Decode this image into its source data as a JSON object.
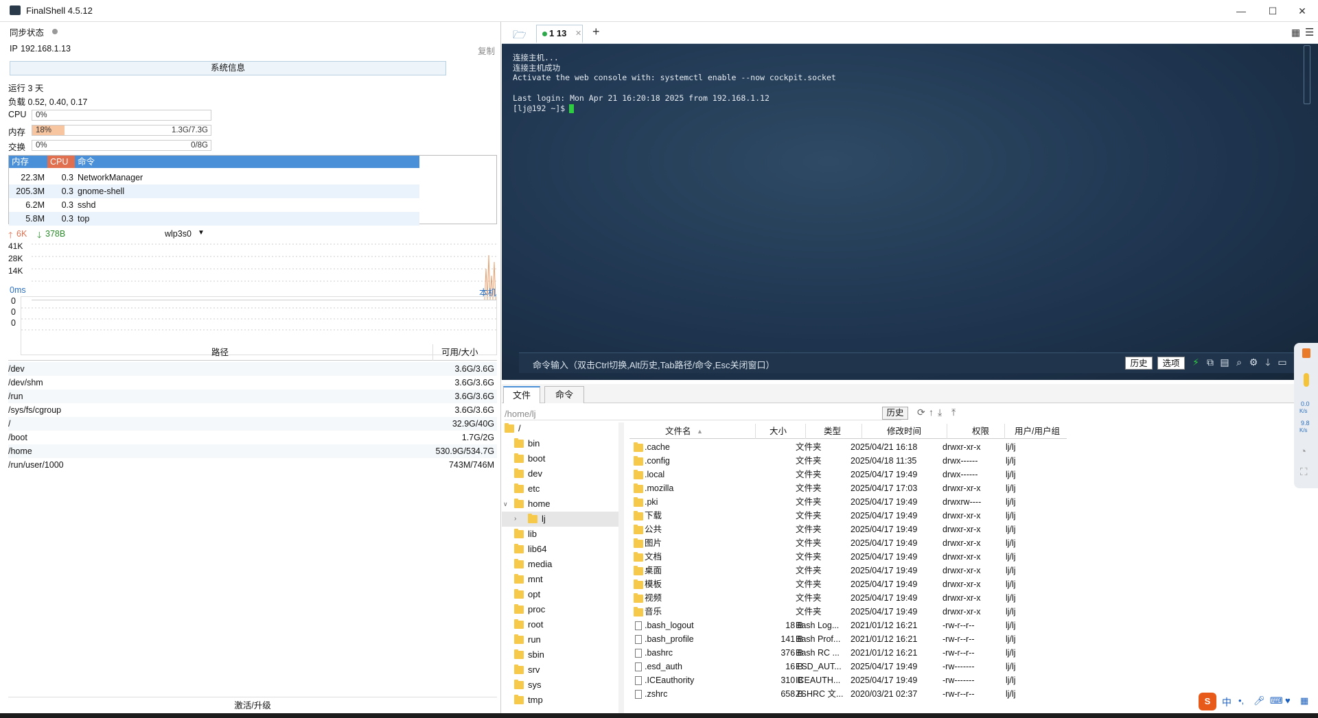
{
  "app": {
    "title": "FinalShell 4.5.12"
  },
  "window": {
    "minimize": "—",
    "maximize": "☐",
    "close": "✕"
  },
  "left": {
    "sync_label": "同步状态",
    "ip_label": "IP",
    "ip_value": "192.168.1.13",
    "copy_label": "复制",
    "sysinfo_button": "系统信息",
    "uptime": "运行 3 天",
    "load": "负载 0.52, 0.40, 0.17",
    "cpu_label": "CPU",
    "cpu_text": "0%",
    "cpu_percent": 0,
    "mem_label": "内存",
    "mem_text": "18%",
    "mem_size": "1.3G/7.3G",
    "mem_percent": 18,
    "swap_label": "交换",
    "swap_text": "0%",
    "swap_size": "0/8G",
    "swap_percent": 0,
    "proc_headers": [
      "内存",
      "CPU",
      "命令"
    ],
    "processes": [
      {
        "mem": "22.3M",
        "cpu": "0.3",
        "cmd": "NetworkManager"
      },
      {
        "mem": "205.3M",
        "cpu": "0.3",
        "cmd": "gnome-shell"
      },
      {
        "mem": "6.2M",
        "cpu": "0.3",
        "cmd": "sshd"
      },
      {
        "mem": "5.8M",
        "cpu": "0.3",
        "cmd": "top"
      }
    ],
    "net_up": "6K",
    "net_down": "378B",
    "net_iface": "wlp3s0",
    "net_ticks": [
      "41K",
      "28K",
      "14K"
    ],
    "ping_label": "0ms",
    "ping_target": "本机",
    "ping_ticks": [
      "0",
      "0",
      "0"
    ],
    "disk_headers": [
      "路径",
      "可用/大小"
    ],
    "disks": [
      {
        "path": "/dev",
        "size": "3.6G/3.6G"
      },
      {
        "path": "/dev/shm",
        "size": "3.6G/3.6G"
      },
      {
        "path": "/run",
        "size": "3.6G/3.6G"
      },
      {
        "path": "/sys/fs/cgroup",
        "size": "3.6G/3.6G"
      },
      {
        "path": "/",
        "size": "32.9G/40G"
      },
      {
        "path": "/boot",
        "size": "1.7G/2G"
      },
      {
        "path": "/home",
        "size": "530.9G/534.7G"
      },
      {
        "path": "/run/user/1000",
        "size": "743M/746M"
      }
    ],
    "activate": "激活/升级"
  },
  "tabs": {
    "session": "1 13",
    "add": "+"
  },
  "terminal": {
    "lines": [
      "连接主机...",
      "连接主机成功",
      "Activate the web console with: systemctl enable --now cockpit.socket",
      "",
      "Last login: Mon Apr 21 16:20:18 2025 from 192.168.1.12",
      "[lj@192 ~]$ "
    ],
    "cmd_hint": "命令输入（双击Ctrl切换,Alt历史,Tab路径/命令,Esc关闭窗口）",
    "history_btn": "历史",
    "options_btn": "选项"
  },
  "files": {
    "tab_files": "文件",
    "tab_cmds": "命令",
    "path": "/home/lj",
    "history_btn": "历史",
    "tree": [
      {
        "name": "/",
        "level": 0
      },
      {
        "name": "bin",
        "level": 1
      },
      {
        "name": "boot",
        "level": 1
      },
      {
        "name": "dev",
        "level": 1
      },
      {
        "name": "etc",
        "level": 1
      },
      {
        "name": "home",
        "level": 1
      },
      {
        "name": "lj",
        "level": 2
      },
      {
        "name": "lib",
        "level": 1
      },
      {
        "name": "lib64",
        "level": 1
      },
      {
        "name": "media",
        "level": 1
      },
      {
        "name": "mnt",
        "level": 1
      },
      {
        "name": "opt",
        "level": 1
      },
      {
        "name": "proc",
        "level": 1
      },
      {
        "name": "root",
        "level": 1
      },
      {
        "name": "run",
        "level": 1
      },
      {
        "name": "sbin",
        "level": 1
      },
      {
        "name": "srv",
        "level": 1
      },
      {
        "name": "sys",
        "level": 1
      },
      {
        "name": "tmp",
        "level": 1
      }
    ],
    "headers": [
      "文件名",
      "大小",
      "类型",
      "修改时间",
      "权限",
      "用户/用户组"
    ],
    "rows": [
      {
        "name": ".cache",
        "size": "",
        "type": "文件夹",
        "time": "2025/04/21 16:18",
        "perm": "drwxr-xr-x",
        "owner": "lj/lj",
        "dir": true
      },
      {
        "name": ".config",
        "size": "",
        "type": "文件夹",
        "time": "2025/04/18 11:35",
        "perm": "drwx------",
        "owner": "lj/lj",
        "dir": true
      },
      {
        "name": ".local",
        "size": "",
        "type": "文件夹",
        "time": "2025/04/17 19:49",
        "perm": "drwx------",
        "owner": "lj/lj",
        "dir": true
      },
      {
        "name": ".mozilla",
        "size": "",
        "type": "文件夹",
        "time": "2025/04/17 17:03",
        "perm": "drwxr-xr-x",
        "owner": "lj/lj",
        "dir": true
      },
      {
        "name": ".pki",
        "size": "",
        "type": "文件夹",
        "time": "2025/04/17 19:49",
        "perm": "drwxrw----",
        "owner": "lj/lj",
        "dir": true
      },
      {
        "name": "下载",
        "size": "",
        "type": "文件夹",
        "time": "2025/04/17 19:49",
        "perm": "drwxr-xr-x",
        "owner": "lj/lj",
        "dir": true
      },
      {
        "name": "公共",
        "size": "",
        "type": "文件夹",
        "time": "2025/04/17 19:49",
        "perm": "drwxr-xr-x",
        "owner": "lj/lj",
        "dir": true
      },
      {
        "name": "图片",
        "size": "",
        "type": "文件夹",
        "time": "2025/04/17 19:49",
        "perm": "drwxr-xr-x",
        "owner": "lj/lj",
        "dir": true
      },
      {
        "name": "文档",
        "size": "",
        "type": "文件夹",
        "time": "2025/04/17 19:49",
        "perm": "drwxr-xr-x",
        "owner": "lj/lj",
        "dir": true
      },
      {
        "name": "桌面",
        "size": "",
        "type": "文件夹",
        "time": "2025/04/17 19:49",
        "perm": "drwxr-xr-x",
        "owner": "lj/lj",
        "dir": true
      },
      {
        "name": "模板",
        "size": "",
        "type": "文件夹",
        "time": "2025/04/17 19:49",
        "perm": "drwxr-xr-x",
        "owner": "lj/lj",
        "dir": true
      },
      {
        "name": "视频",
        "size": "",
        "type": "文件夹",
        "time": "2025/04/17 19:49",
        "perm": "drwxr-xr-x",
        "owner": "lj/lj",
        "dir": true
      },
      {
        "name": "音乐",
        "size": "",
        "type": "文件夹",
        "time": "2025/04/17 19:49",
        "perm": "drwxr-xr-x",
        "owner": "lj/lj",
        "dir": true
      },
      {
        "name": ".bash_logout",
        "size": "18 B",
        "type": "Bash Log...",
        "time": "2021/01/12 16:21",
        "perm": "-rw-r--r--",
        "owner": "lj/lj",
        "dir": false
      },
      {
        "name": ".bash_profile",
        "size": "141 B",
        "type": "Bash Prof...",
        "time": "2021/01/12 16:21",
        "perm": "-rw-r--r--",
        "owner": "lj/lj",
        "dir": false
      },
      {
        "name": ".bashrc",
        "size": "376 B",
        "type": "Bash RC ...",
        "time": "2021/01/12 16:21",
        "perm": "-rw-r--r--",
        "owner": "lj/lj",
        "dir": false
      },
      {
        "name": ".esd_auth",
        "size": "16 B",
        "type": "ESD_AUT...",
        "time": "2025/04/17 19:49",
        "perm": "-rw-------",
        "owner": "lj/lj",
        "dir": false
      },
      {
        "name": ".ICEauthority",
        "size": "310 B",
        "type": "ICEAUTH...",
        "time": "2025/04/17 19:49",
        "perm": "-rw-------",
        "owner": "lj/lj",
        "dir": false
      },
      {
        "name": ".zshrc",
        "size": "658 B",
        "type": "ZSHRC 文...",
        "time": "2020/03/21 02:37",
        "perm": "-rw-r--r--",
        "owner": "lj/lj",
        "dir": false
      }
    ]
  },
  "side": {
    "up": "0.0",
    "up_unit": "K/s",
    "down": "9.8",
    "down_unit": "K/s"
  },
  "tray": {
    "ime": "中"
  },
  "colors": {
    "accent": "#4a90d9",
    "terminal_bg": "#1f3550",
    "cpu_header": "#e07050",
    "mem_bar": "#f7c5a0"
  }
}
